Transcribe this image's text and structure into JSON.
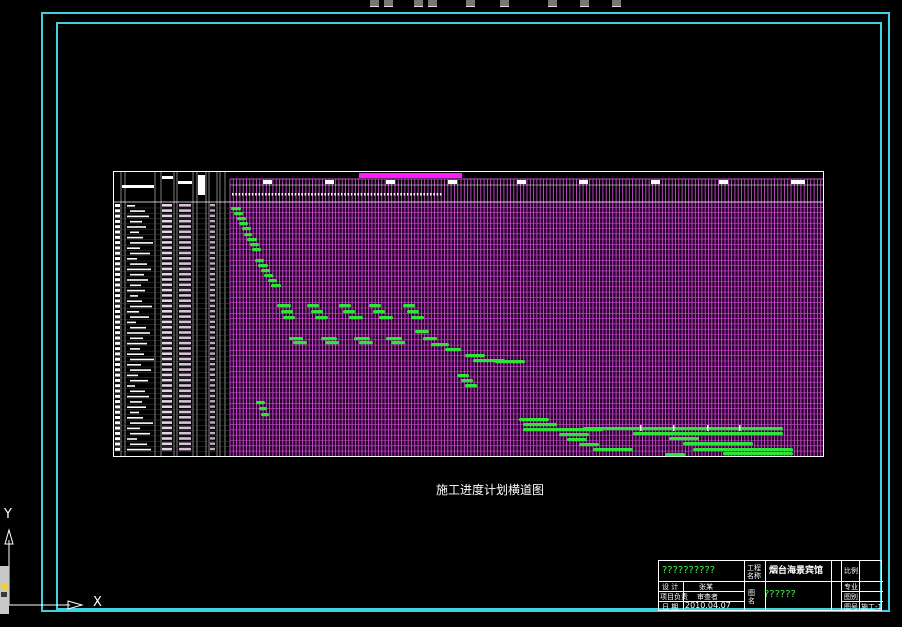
{
  "app": {
    "toolbar_icons": [
      "pan-icon",
      "zoom-icon",
      "undo-icon",
      "redo-icon",
      "properties-icon",
      "layer-icon",
      "match-icon",
      "block-icon",
      "print-icon"
    ]
  },
  "drawing": {
    "title": "施工进度计划横道图"
  },
  "title_block": {
    "company": "??????????",
    "project_label": "工程名称",
    "project_name": "烟台海景宾馆",
    "designer_label": "设 计",
    "designer_value": "张某",
    "checker_label": "项目负责",
    "checker_value": "审查者",
    "date_label": "日 期",
    "date_value": "2010.04.07",
    "drawing_label": "图名",
    "drawing_name": "??????",
    "right_labels": [
      "比例",
      "专业",
      "图别",
      "图号"
    ],
    "sheet_no": "施工-1"
  },
  "ucs": {
    "x_label": "X",
    "y_label": "Y"
  },
  "colors": {
    "background": "#000000",
    "frame": "#3fd1e0",
    "grid": "#d04ad6",
    "bars": "#2fe33a",
    "header_magenta": "#ff1aff"
  }
}
